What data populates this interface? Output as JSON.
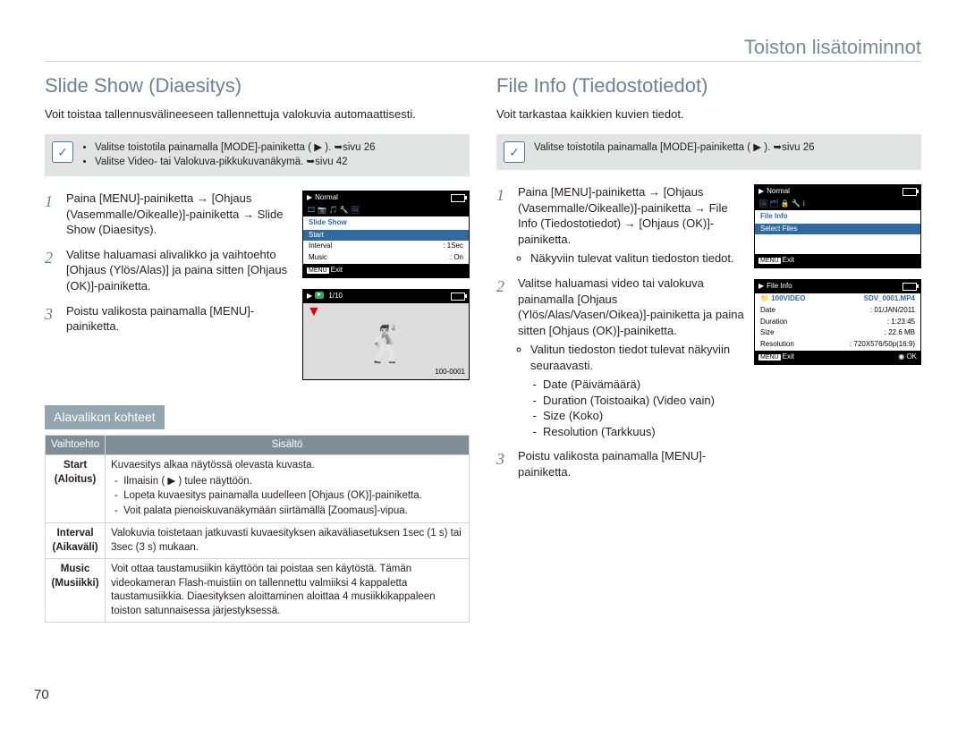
{
  "header": {
    "title": "Toiston lisätoiminnot"
  },
  "page_number": "70",
  "left": {
    "heading": "Slide Show (Diaesitys)",
    "intro": "Voit toistaa tallennusvälineeseen tallennettuja valokuvia automaattisesti.",
    "note": {
      "bullets": [
        "Valitse toistotila painamalla [MODE]-painiketta ( ▶ ). ➥sivu 26",
        "Valitse Video- tai Valokuva-pikkukuvanäkymä. ➥sivu 42"
      ]
    },
    "steps": [
      "Paina [MENU]-painiketta → [Ohjaus (Vasemmalle/Oikealle)]-painiketta → Slide Show (Diaesitys).",
      "Valitse haluamasi alivalikko ja vaihtoehto [Ohjaus (Ylös/Alas)] ja paina sitten [Ohjaus (OK)]-painiketta.",
      "Poistu valikosta painamalla [MENU]-painiketta."
    ],
    "lcd1": {
      "mode": "Normal",
      "title": "Slide Show",
      "items": [
        {
          "label": "Start",
          "value": ""
        },
        {
          "label": "Interval",
          "value": ": 1Sec"
        },
        {
          "label": "Music",
          "value": ": On"
        }
      ],
      "exit_label": "Exit",
      "menu_label": "MENU"
    },
    "lcd2": {
      "counter": "1/10",
      "file_id": "100-0001"
    },
    "sub_header": "Alavalikon kohteet",
    "table": {
      "head": [
        "Vaihtoehto",
        "Sisältö"
      ],
      "rows": [
        {
          "opt": "Start\n(Aloitus)",
          "desc_lead": "Kuvaesitys alkaa näytössä olevasta kuvasta.",
          "desc_items": [
            "Ilmaisin ( ▶ ) tulee näyttöön.",
            "Lopeta kuvaesitys painamalla uudelleen [Ohjaus (OK)]-painiketta.",
            "Voit palata pienoiskuvanäkymään siirtämällä [Zoomaus]-vipua."
          ]
        },
        {
          "opt": "Interval\n(Aikaväli)",
          "desc": "Valokuvia toistetaan jatkuvasti kuvaesityksen aikaväliasetuksen 1sec (1 s) tai 3sec (3 s) mukaan."
        },
        {
          "opt": "Music\n(Musiikki)",
          "desc": "Voit ottaa taustamusiikin käyttöön tai poistaa sen käytöstä. Tämän videokameran Flash-muistiin on tallennettu valmiiksi 4 kappaletta taustamusiikkia. Diaesityksen aloittaminen aloittaa 4 musiikkikappaleen toiston satunnaisessa järjestyksessä."
        }
      ]
    }
  },
  "right": {
    "heading": "File Info (Tiedostotiedot)",
    "intro": "Voit tarkastaa kaikkien kuvien tiedot.",
    "note": {
      "text": "Valitse toistotila painamalla [MODE]-painiketta ( ▶ ). ➥sivu 26"
    },
    "steps": [
      {
        "text": "Paina [MENU]-painiketta → [Ohjaus (Vasemmalle/Oikealle)]-painiketta → File Info (Tiedostotiedot) → [Ohjaus (OK)]-painiketta.",
        "sub": [
          "Näkyviin tulevat valitun tiedoston tiedot."
        ]
      },
      {
        "text": "Valitse haluamasi video tai valokuva painamalla [Ohjaus (Ylös/Alas/Vasen/Oikea)]-painiketta ja paina sitten [Ohjaus (OK)]-painiketta.",
        "sub": [
          "Valitun tiedoston tiedot tulevat näkyviin seuraavasti."
        ],
        "detail_items": [
          "Date (Päivämäärä)",
          "Duration (Toistoaika) (Video vain)",
          "Size (Koko)",
          "Resolution (Tarkkuus)"
        ]
      },
      {
        "text": "Poistu valikosta painamalla [MENU]-painiketta."
      }
    ],
    "lcd_a": {
      "mode": "Normal",
      "items": [
        {
          "label": "File Info",
          "value": ""
        },
        {
          "label": "Select Files",
          "value": ""
        }
      ],
      "exit_label": "Exit",
      "menu_label": "MENU"
    },
    "lcd_b": {
      "title": "File Info",
      "folder": "100VIDEO",
      "filename": "SDV_0001.MP4",
      "rows": [
        {
          "k": "Date",
          "v": ": 01/JAN/2011"
        },
        {
          "k": "Duration",
          "v": ": 1:23:45"
        },
        {
          "k": "Size",
          "v": ": 22.6 MB"
        },
        {
          "k": "Resolution",
          "v": ": 720X576/50p(16:9)"
        }
      ],
      "exit_label": "Exit",
      "ok_label": "OK",
      "menu_label": "MENU"
    }
  }
}
